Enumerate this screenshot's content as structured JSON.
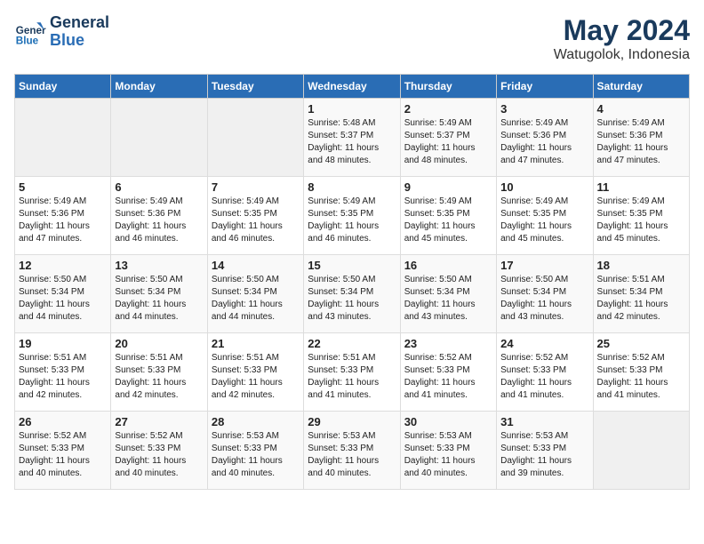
{
  "header": {
    "logo_line1": "General",
    "logo_line2": "Blue",
    "month": "May 2024",
    "location": "Watugolok, Indonesia"
  },
  "weekdays": [
    "Sunday",
    "Monday",
    "Tuesday",
    "Wednesday",
    "Thursday",
    "Friday",
    "Saturday"
  ],
  "weeks": [
    [
      {
        "day": "",
        "text": ""
      },
      {
        "day": "",
        "text": ""
      },
      {
        "day": "",
        "text": ""
      },
      {
        "day": "1",
        "text": "Sunrise: 5:48 AM\nSunset: 5:37 PM\nDaylight: 11 hours\nand 48 minutes."
      },
      {
        "day": "2",
        "text": "Sunrise: 5:49 AM\nSunset: 5:37 PM\nDaylight: 11 hours\nand 48 minutes."
      },
      {
        "day": "3",
        "text": "Sunrise: 5:49 AM\nSunset: 5:36 PM\nDaylight: 11 hours\nand 47 minutes."
      },
      {
        "day": "4",
        "text": "Sunrise: 5:49 AM\nSunset: 5:36 PM\nDaylight: 11 hours\nand 47 minutes."
      }
    ],
    [
      {
        "day": "5",
        "text": "Sunrise: 5:49 AM\nSunset: 5:36 PM\nDaylight: 11 hours\nand 47 minutes."
      },
      {
        "day": "6",
        "text": "Sunrise: 5:49 AM\nSunset: 5:36 PM\nDaylight: 11 hours\nand 46 minutes."
      },
      {
        "day": "7",
        "text": "Sunrise: 5:49 AM\nSunset: 5:35 PM\nDaylight: 11 hours\nand 46 minutes."
      },
      {
        "day": "8",
        "text": "Sunrise: 5:49 AM\nSunset: 5:35 PM\nDaylight: 11 hours\nand 46 minutes."
      },
      {
        "day": "9",
        "text": "Sunrise: 5:49 AM\nSunset: 5:35 PM\nDaylight: 11 hours\nand 45 minutes."
      },
      {
        "day": "10",
        "text": "Sunrise: 5:49 AM\nSunset: 5:35 PM\nDaylight: 11 hours\nand 45 minutes."
      },
      {
        "day": "11",
        "text": "Sunrise: 5:49 AM\nSunset: 5:35 PM\nDaylight: 11 hours\nand 45 minutes."
      }
    ],
    [
      {
        "day": "12",
        "text": "Sunrise: 5:50 AM\nSunset: 5:34 PM\nDaylight: 11 hours\nand 44 minutes."
      },
      {
        "day": "13",
        "text": "Sunrise: 5:50 AM\nSunset: 5:34 PM\nDaylight: 11 hours\nand 44 minutes."
      },
      {
        "day": "14",
        "text": "Sunrise: 5:50 AM\nSunset: 5:34 PM\nDaylight: 11 hours\nand 44 minutes."
      },
      {
        "day": "15",
        "text": "Sunrise: 5:50 AM\nSunset: 5:34 PM\nDaylight: 11 hours\nand 43 minutes."
      },
      {
        "day": "16",
        "text": "Sunrise: 5:50 AM\nSunset: 5:34 PM\nDaylight: 11 hours\nand 43 minutes."
      },
      {
        "day": "17",
        "text": "Sunrise: 5:50 AM\nSunset: 5:34 PM\nDaylight: 11 hours\nand 43 minutes."
      },
      {
        "day": "18",
        "text": "Sunrise: 5:51 AM\nSunset: 5:34 PM\nDaylight: 11 hours\nand 42 minutes."
      }
    ],
    [
      {
        "day": "19",
        "text": "Sunrise: 5:51 AM\nSunset: 5:33 PM\nDaylight: 11 hours\nand 42 minutes."
      },
      {
        "day": "20",
        "text": "Sunrise: 5:51 AM\nSunset: 5:33 PM\nDaylight: 11 hours\nand 42 minutes."
      },
      {
        "day": "21",
        "text": "Sunrise: 5:51 AM\nSunset: 5:33 PM\nDaylight: 11 hours\nand 42 minutes."
      },
      {
        "day": "22",
        "text": "Sunrise: 5:51 AM\nSunset: 5:33 PM\nDaylight: 11 hours\nand 41 minutes."
      },
      {
        "day": "23",
        "text": "Sunrise: 5:52 AM\nSunset: 5:33 PM\nDaylight: 11 hours\nand 41 minutes."
      },
      {
        "day": "24",
        "text": "Sunrise: 5:52 AM\nSunset: 5:33 PM\nDaylight: 11 hours\nand 41 minutes."
      },
      {
        "day": "25",
        "text": "Sunrise: 5:52 AM\nSunset: 5:33 PM\nDaylight: 11 hours\nand 41 minutes."
      }
    ],
    [
      {
        "day": "26",
        "text": "Sunrise: 5:52 AM\nSunset: 5:33 PM\nDaylight: 11 hours\nand 40 minutes."
      },
      {
        "day": "27",
        "text": "Sunrise: 5:52 AM\nSunset: 5:33 PM\nDaylight: 11 hours\nand 40 minutes."
      },
      {
        "day": "28",
        "text": "Sunrise: 5:53 AM\nSunset: 5:33 PM\nDaylight: 11 hours\nand 40 minutes."
      },
      {
        "day": "29",
        "text": "Sunrise: 5:53 AM\nSunset: 5:33 PM\nDaylight: 11 hours\nand 40 minutes."
      },
      {
        "day": "30",
        "text": "Sunrise: 5:53 AM\nSunset: 5:33 PM\nDaylight: 11 hours\nand 40 minutes."
      },
      {
        "day": "31",
        "text": "Sunrise: 5:53 AM\nSunset: 5:33 PM\nDaylight: 11 hours\nand 39 minutes."
      },
      {
        "day": "",
        "text": ""
      }
    ]
  ]
}
